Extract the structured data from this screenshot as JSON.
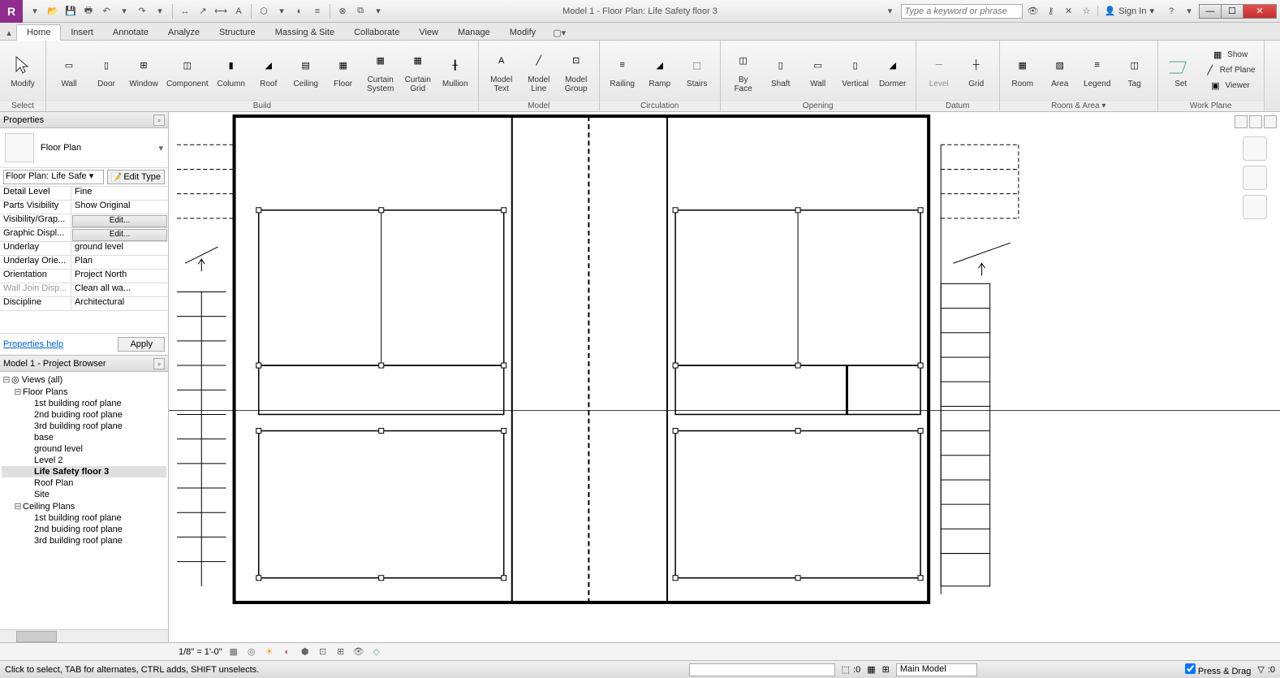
{
  "title": "Model 1 - Floor Plan: Life Safety floor 3",
  "search_placeholder": "Type a keyword or phrase",
  "signin": "Sign In",
  "tabs": [
    "Home",
    "Insert",
    "Annotate",
    "Analyze",
    "Structure",
    "Massing & Site",
    "Collaborate",
    "View",
    "Manage",
    "Modify"
  ],
  "active_tab": "Home",
  "ribbon_panels": {
    "select": {
      "label": "Select",
      "btn": "Modify"
    },
    "build": {
      "label": "Build",
      "btns": [
        "Wall",
        "Door",
        "Window",
        "Component",
        "Column",
        "Roof",
        "Ceiling",
        "Floor",
        "Curtain\nSystem",
        "Curtain\nGrid",
        "Mullion"
      ]
    },
    "model": {
      "label": "Model",
      "btns": [
        "Model\nText",
        "Model\nLine",
        "Model\nGroup"
      ]
    },
    "circulation": {
      "label": "Circulation",
      "btns": [
        "Railing",
        "Ramp",
        "Stairs"
      ]
    },
    "opening": {
      "label": "Opening",
      "btns": [
        "By\nFace",
        "Shaft",
        "Wall",
        "Vertical",
        "Dormer"
      ]
    },
    "datum": {
      "label": "Datum",
      "btns": [
        "Level",
        "Grid"
      ]
    },
    "room_area": {
      "label": "Room & Area ▾",
      "btns": [
        "Room",
        "Area",
        "Legend",
        "Tag"
      ]
    },
    "workplane": {
      "label": "Work Plane",
      "btns": [
        "Set"
      ],
      "small": [
        "Show",
        "Ref Plane",
        "Viewer"
      ]
    }
  },
  "properties": {
    "title": "Properties",
    "type_name": "Floor Plan",
    "view_select": "Floor Plan: Life Safe",
    "edit_type": "Edit Type",
    "rows": [
      {
        "l": "Detail Level",
        "r": "Fine"
      },
      {
        "l": "Parts Visibility",
        "r": "Show Original"
      },
      {
        "l": "Visibility/Grap...",
        "r": "Edit...",
        "btn": true
      },
      {
        "l": "Graphic Displ...",
        "r": "Edit...",
        "btn": true
      },
      {
        "l": "Underlay",
        "r": "ground level"
      },
      {
        "l": "Underlay Orie...",
        "r": "Plan"
      },
      {
        "l": "Orientation",
        "r": "Project North"
      },
      {
        "l": "Wall Join Disp...",
        "r": "Clean all wa...",
        "dis": true
      },
      {
        "l": "Discipline",
        "r": "Architectural"
      }
    ],
    "help": "Properties help",
    "apply": "Apply"
  },
  "browser": {
    "title": "Model 1 - Project Browser",
    "root": "Views (all)",
    "floor_plans": "Floor Plans",
    "fp_items": [
      "1st building roof plane",
      "2nd buiding roof plane",
      "3rd building roof plane",
      "base",
      "ground level",
      "Level 2",
      "Life Safety floor 3",
      "Roof Plan",
      "Site"
    ],
    "selected": "Life Safety floor 3",
    "ceiling_plans": "Ceiling Plans",
    "cp_items": [
      "1st building roof plane",
      "2nd buiding roof plane",
      "3rd building roof plane"
    ]
  },
  "view_scale": "1/8\" = 1'-0\"",
  "statusbar": {
    "hint": "Click to select, TAB for alternates, CTRL adds, SHIFT unselects.",
    "count": ":0",
    "model": "Main Model",
    "pressdrag": "Press & Drag",
    "filter": ":0"
  }
}
